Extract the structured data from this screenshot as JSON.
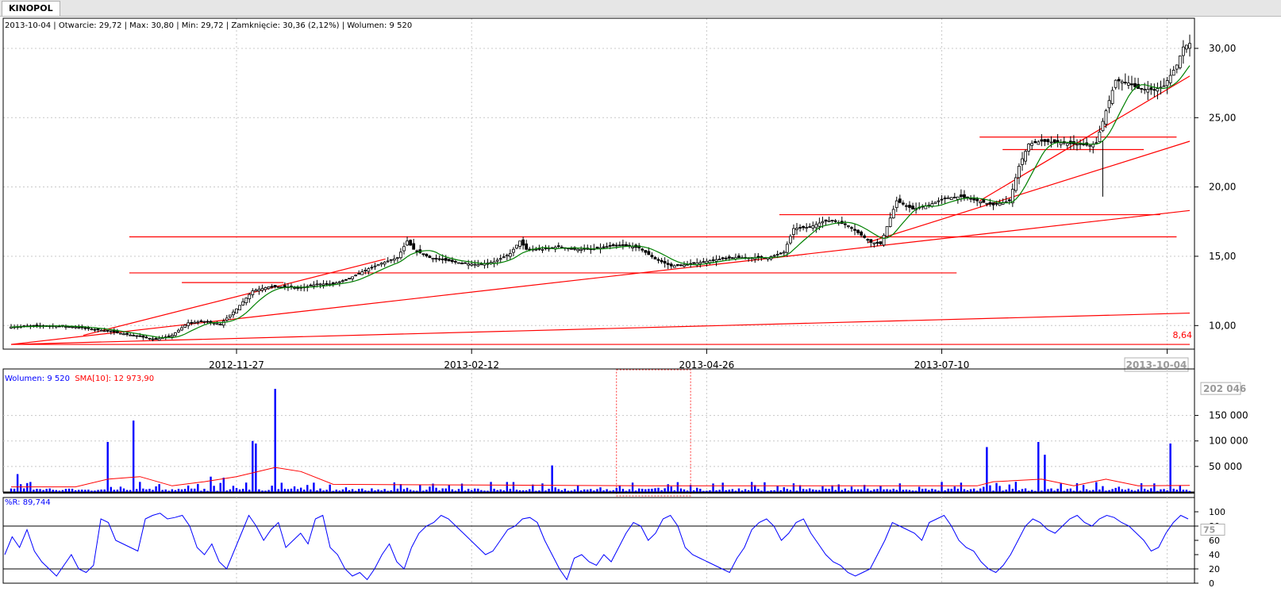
{
  "tab": {
    "label": "KINOPOL"
  },
  "info_line": "2013-10-04 | Otwarcie: 29,72 | Max: 30,80 | Min: 29,72 | Zamknięcie: 30,36 (2,12%)  | Wolumen: 9 520",
  "volume_legend": {
    "volume": "Wolumen: 9 520",
    "sma": "SMA[10]: 12 973,90"
  },
  "wr_legend": "%R: 89,744",
  "colors": {
    "price_up": "#ffffff",
    "price_down": "#000000",
    "sma": "#008000",
    "trend": "#ff0000",
    "volume": "#0000ff",
    "volume_sma": "#ff0000",
    "wr": "#0000ff"
  },
  "chart_data": [
    {
      "type": "candlestick",
      "name": "price",
      "x_ticks": [
        "2012-11-27",
        "2013-02-12",
        "2013-04-26",
        "2013-07-10",
        "201"
      ],
      "current_date_label": "2013-10-04",
      "y_ticks": [
        "10,00",
        "15,00",
        "20,00",
        "25,00",
        "30,00"
      ],
      "ylim": [
        8.3,
        31.2
      ],
      "min_marker": "8,64",
      "close_trace": [
        [
          0,
          9.9
        ],
        [
          10,
          10.0
        ],
        [
          20,
          9.9
        ],
        [
          30,
          9.6
        ],
        [
          40,
          9.2
        ],
        [
          45,
          9.0
        ],
        [
          50,
          9.3
        ],
        [
          55,
          10.2
        ],
        [
          60,
          10.3
        ],
        [
          65,
          10.1
        ],
        [
          70,
          11.2
        ],
        [
          75,
          12.5
        ],
        [
          80,
          12.8
        ],
        [
          85,
          12.8
        ],
        [
          90,
          12.7
        ],
        [
          95,
          13.0
        ],
        [
          100,
          13.0
        ],
        [
          105,
          13.4
        ],
        [
          110,
          14.0
        ],
        [
          115,
          14.5
        ],
        [
          120,
          14.9
        ],
        [
          123,
          16.1
        ],
        [
          125,
          15.5
        ],
        [
          130,
          14.9
        ],
        [
          135,
          14.7
        ],
        [
          140,
          14.5
        ],
        [
          145,
          14.4
        ],
        [
          150,
          14.6
        ],
        [
          155,
          15.2
        ],
        [
          158,
          16.1
        ],
        [
          160,
          15.5
        ],
        [
          165,
          15.5
        ],
        [
          170,
          15.7
        ],
        [
          175,
          15.5
        ],
        [
          180,
          15.5
        ],
        [
          185,
          15.7
        ],
        [
          190,
          15.8
        ],
        [
          195,
          15.6
        ],
        [
          200,
          14.8
        ],
        [
          205,
          14.3
        ],
        [
          210,
          14.4
        ],
        [
          215,
          14.6
        ],
        [
          220,
          14.8
        ],
        [
          225,
          14.9
        ],
        [
          230,
          14.9
        ],
        [
          235,
          14.9
        ],
        [
          240,
          15.3
        ],
        [
          243,
          17.0
        ],
        [
          248,
          17.1
        ],
        [
          252,
          17.5
        ],
        [
          255,
          17.6
        ],
        [
          260,
          17.2
        ],
        [
          263,
          16.7
        ],
        [
          267,
          16.0
        ],
        [
          270,
          15.9
        ],
        [
          275,
          19.0
        ],
        [
          280,
          18.4
        ],
        [
          285,
          18.7
        ],
        [
          290,
          19.2
        ],
        [
          295,
          19.3
        ],
        [
          300,
          19.0
        ],
        [
          305,
          18.7
        ],
        [
          310,
          19.0
        ],
        [
          313,
          21.5
        ],
        [
          316,
          23.1
        ],
        [
          320,
          23.3
        ],
        [
          325,
          23.2
        ],
        [
          330,
          23.1
        ],
        [
          335,
          23.0
        ],
        [
          337,
          23.2
        ],
        [
          340,
          25.5
        ],
        [
          343,
          27.7
        ],
        [
          347,
          27.5
        ],
        [
          350,
          27.1
        ],
        [
          355,
          27.0
        ],
        [
          358,
          27.3
        ],
        [
          362,
          28.8
        ],
        [
          364,
          30.1
        ],
        [
          366,
          30.36
        ]
      ],
      "trend_lines": [
        {
          "from": [
            "2012-10-10",
            8.64
          ],
          "to": [
            "2013-10-04",
            8.64
          ]
        },
        {
          "from": [
            "2012-10-10",
            8.64
          ],
          "to": [
            "2013-10-04",
            10.9
          ]
        },
        {
          "from": [
            "2012-10-10",
            8.64
          ],
          "to": [
            "2013-10-04",
            18.3
          ]
        },
        {
          "from": [
            "2012-11-01",
            9.3
          ],
          "to": [
            "2013-02-01",
            14.8
          ]
        },
        {
          "from": [
            "2013-06-28",
            16.0
          ],
          "to": [
            "2013-10-04",
            23.3
          ]
        },
        {
          "from": [
            "2013-08-01",
            19.0
          ],
          "to": [
            "2013-10-04",
            28.0
          ]
        },
        {
          "from": [
            "2012-11-15",
            16.4
          ],
          "to": [
            "2013-09-30",
            16.4
          ]
        },
        {
          "from": [
            "2012-11-15",
            13.8
          ],
          "to": [
            "2013-07-25",
            13.8
          ]
        },
        {
          "from": [
            "2012-12-01",
            13.1
          ],
          "to": [
            "2013-01-01",
            13.1
          ]
        },
        {
          "from": [
            "2013-06-01",
            18.0
          ],
          "to": [
            "2013-09-25",
            18.0
          ]
        },
        {
          "from": [
            "2013-08-01",
            23.6
          ],
          "to": [
            "2013-09-30",
            23.6
          ]
        },
        {
          "from": [
            "2013-08-08",
            22.7
          ],
          "to": [
            "2013-09-20",
            22.7
          ]
        }
      ]
    },
    {
      "type": "bar",
      "name": "volume",
      "y_ticks": [
        "50 000",
        "100 000",
        "150 000"
      ],
      "max_label": "202 046",
      "ylim": [
        0,
        210000
      ],
      "spikes": [
        [
          2,
          35000
        ],
        [
          30,
          98000
        ],
        [
          38,
          140000
        ],
        [
          62,
          30000
        ],
        [
          66,
          28000
        ],
        [
          75,
          100000
        ],
        [
          76,
          95000
        ],
        [
          82,
          202046
        ],
        [
          168,
          52000
        ],
        [
          303,
          88000
        ],
        [
          319,
          98000
        ],
        [
          321,
          73000
        ],
        [
          360,
          95000
        ]
      ],
      "sma_trace": [
        [
          0,
          10000
        ],
        [
          20,
          10000
        ],
        [
          30,
          25000
        ],
        [
          40,
          30000
        ],
        [
          50,
          12000
        ],
        [
          60,
          20000
        ],
        [
          70,
          30000
        ],
        [
          82,
          48000
        ],
        [
          90,
          40000
        ],
        [
          100,
          15000
        ],
        [
          200,
          12000
        ],
        [
          300,
          12000
        ],
        [
          305,
          20000
        ],
        [
          320,
          25000
        ],
        [
          330,
          12000
        ],
        [
          340,
          25000
        ],
        [
          350,
          12000
        ],
        [
          366,
          12974
        ]
      ]
    },
    {
      "type": "line",
      "name": "%R",
      "y_ticks": [
        "0",
        "20",
        "40",
        "60",
        "80",
        "100"
      ],
      "current_marker": "75",
      "ylim": [
        0,
        100
      ],
      "hlines": [
        20,
        80
      ],
      "series": [
        {
          "values": [
            40,
            65,
            50,
            75,
            45,
            30,
            20,
            10,
            25,
            40,
            20,
            15,
            25,
            90,
            85,
            60,
            55,
            50,
            45,
            90,
            95,
            98,
            90,
            92,
            95,
            80,
            50,
            40,
            55,
            30,
            20,
            45,
            70,
            95,
            80,
            60,
            75,
            85,
            50,
            60,
            70,
            55,
            90,
            95,
            50,
            40,
            20,
            10,
            15,
            5,
            20,
            40,
            55,
            30,
            20,
            50,
            70,
            80,
            85,
            95,
            90,
            80,
            70,
            60,
            50,
            40,
            45,
            60,
            75,
            80,
            90,
            92,
            85,
            60,
            40,
            20,
            5,
            35,
            40,
            30,
            25,
            40,
            30,
            50,
            70,
            85,
            80,
            60,
            70,
            90,
            95,
            80,
            50,
            40,
            35,
            30,
            25,
            20,
            15,
            35,
            50,
            75,
            85,
            90,
            80,
            60,
            70,
            85,
            90,
            70,
            55,
            40,
            30,
            25,
            15,
            10,
            15,
            20,
            40,
            60,
            85,
            80,
            75,
            70,
            60,
            85,
            90,
            95,
            80,
            60,
            50,
            45,
            30,
            20,
            15,
            25,
            40,
            60,
            80,
            90,
            85,
            75,
            70,
            80,
            90,
            95,
            85,
            80,
            90,
            95,
            92,
            85,
            80,
            70,
            60,
            45,
            50,
            70,
            85,
            95,
            90
          ]
        }
      ]
    }
  ]
}
